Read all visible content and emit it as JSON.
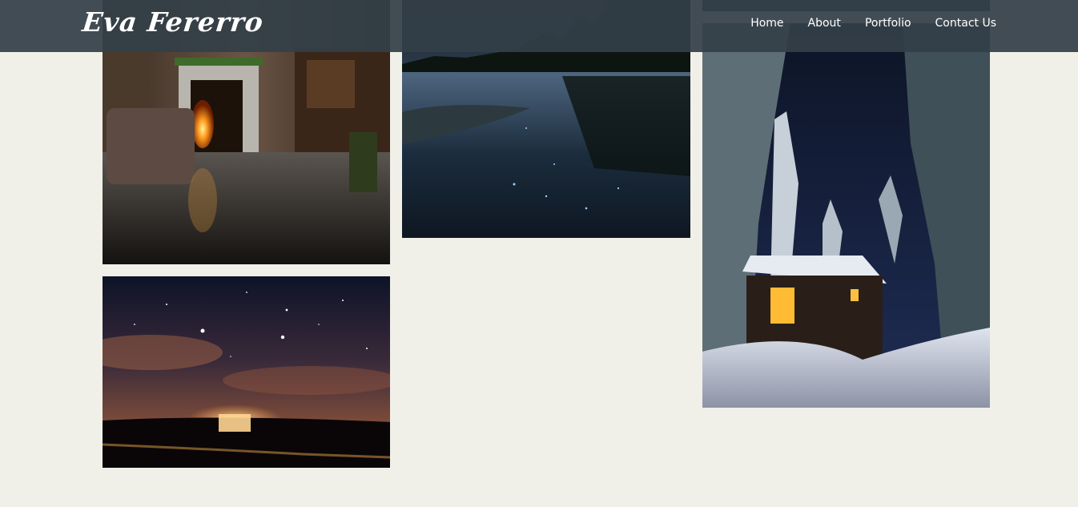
{
  "brand": {
    "name": "Eva Fererro"
  },
  "nav": {
    "items": [
      {
        "label": "Home"
      },
      {
        "label": "About"
      },
      {
        "label": "Portfolio"
      },
      {
        "label": "Contact Us"
      }
    ]
  },
  "colors": {
    "page_background": "#f0f0e9",
    "header_background": "#344048",
    "header_text": "#ffffff"
  },
  "gallery": {
    "images": [
      {
        "subject": "fireplace-room-photo"
      },
      {
        "subject": "night-lake-photo"
      },
      {
        "subject": "gallery-image-cropped"
      },
      {
        "subject": "snowy-cabin-photo"
      },
      {
        "subject": "starry-night-sky-photo"
      }
    ]
  }
}
